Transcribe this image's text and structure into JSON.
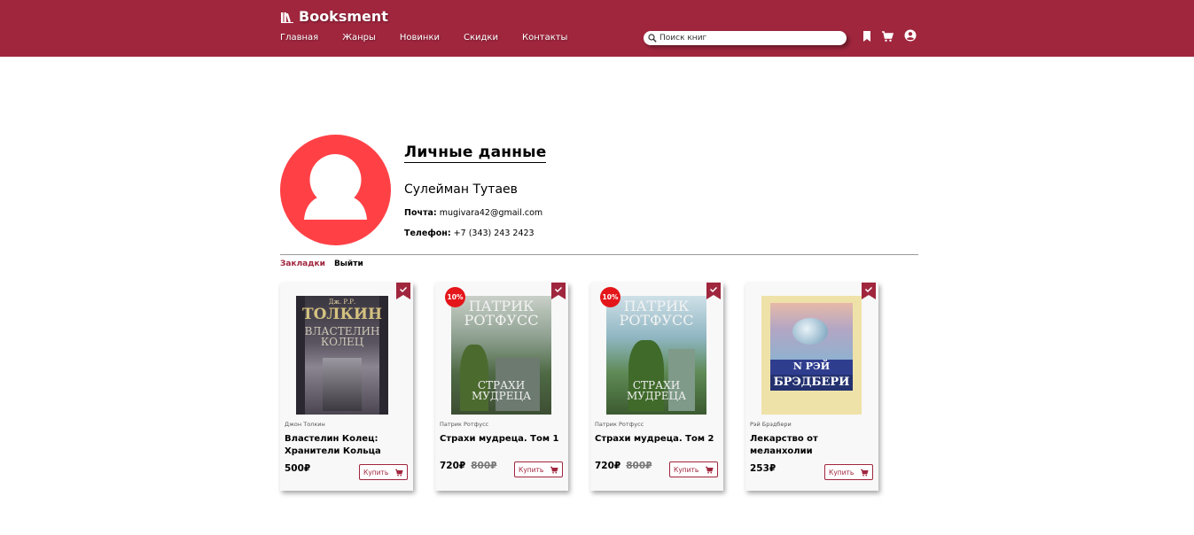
{
  "brand": {
    "name": "Booksment",
    "color": "#a0263e"
  },
  "nav": [
    "Главная",
    "Жанры",
    "Новинки",
    "Скидки",
    "Контакты"
  ],
  "search": {
    "placeholder": "Поиск книг",
    "value": ""
  },
  "header_icons": [
    "bookmark-icon",
    "cart-icon",
    "user-circle-icon"
  ],
  "profile": {
    "section_title": "Личные данные",
    "name": "Сулейман Тутаев",
    "email_label": "Почта:",
    "email": "mugivara42@gmail.com",
    "phone_label": "Телефон:",
    "phone": "+7 (343) 243 2423",
    "avatar_color": "#ff4146"
  },
  "tabs": {
    "bookmarks": "Закладки",
    "logout": "Выйти"
  },
  "books": [
    {
      "author": "Джон Толкин",
      "title": "Властелин Колец: Хранители Кольца",
      "price": "500₽",
      "old_price": "",
      "discount": "",
      "buy_label": "Купить"
    },
    {
      "author": "Патрик Ротфусс",
      "title": "Страхи мудреца. Том 1",
      "price": "720₽",
      "old_price": "800₽",
      "discount": "10%",
      "buy_label": "Купить"
    },
    {
      "author": "Патрик Ротфусс",
      "title": "Страхи мудреца. Том 2",
      "price": "720₽",
      "old_price": "800₽",
      "discount": "10%",
      "buy_label": "Купить"
    },
    {
      "author": "Рэй Брэдбери",
      "title": "Лекарство от меланхолии",
      "price": "253₽",
      "old_price": "",
      "discount": "",
      "buy_label": "Купить"
    }
  ]
}
